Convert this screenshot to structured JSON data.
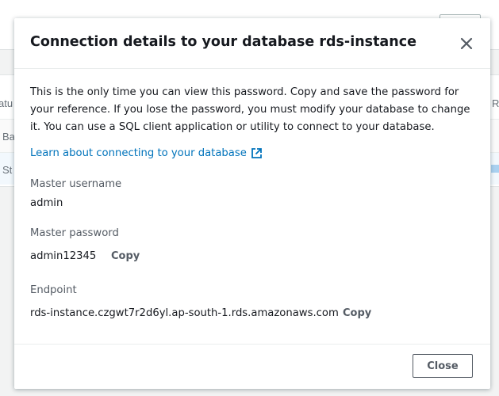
{
  "modal": {
    "title": "Connection details to your database rds-instance",
    "intro": "This is the only time you can view this password. Copy and save the password for your reference. If you lose the password, you must modify your database to change it. You can use a SQL client application or utility to connect to your database.",
    "learn_link": "Learn about connecting to your database",
    "fields": [
      {
        "label": "Master username",
        "value": "admin"
      },
      {
        "label": "Master password",
        "value": "admin12345",
        "copy": "Copy"
      },
      {
        "label": "Endpoint",
        "value": "rds-instance.czgwt7r2d6yl.ap-south-1.rds.amazonaws.com",
        "copy": "Copy"
      }
    ],
    "close_button": "Close"
  },
  "background": {
    "fragments": [
      "atu",
      "Ba",
      "St",
      "R"
    ]
  },
  "colors": {
    "link": "#0073bb",
    "text": "#16191f",
    "label": "#545b64",
    "overlay_bg": "#f2f3f3"
  },
  "icons": {
    "close": "close-icon",
    "external": "external-link-icon"
  }
}
